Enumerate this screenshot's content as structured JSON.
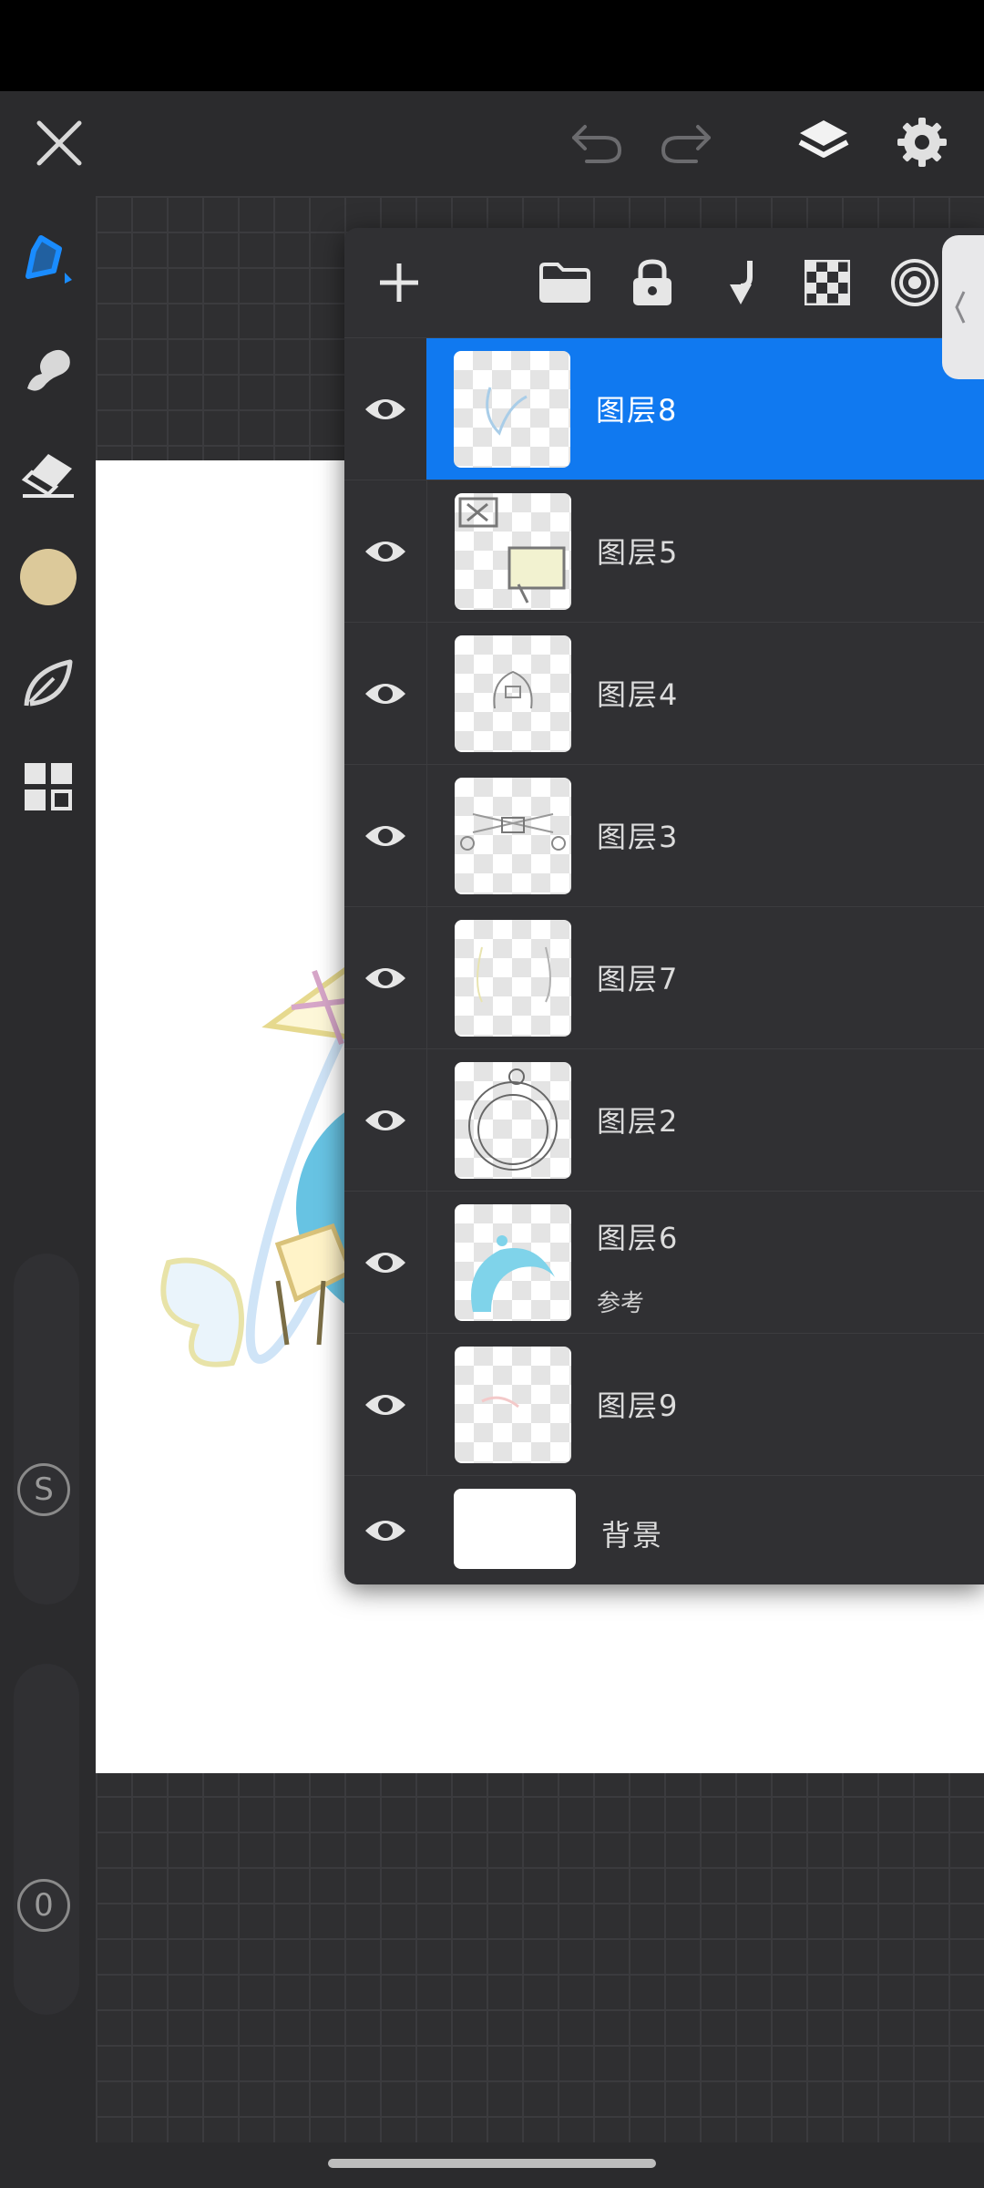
{
  "colors": {
    "accent": "#1079f0",
    "current_color": "#dcc99a",
    "panel_bg": "#303033",
    "toolbar_bg": "#2b2b2d"
  },
  "topbar": {
    "icons": [
      "close-icon",
      "undo-icon",
      "redo-icon",
      "layers-icon",
      "settings-icon"
    ]
  },
  "toolbar": {
    "tools": [
      "brush-icon",
      "smudge-icon",
      "eraser-icon",
      "color-swatch",
      "leaf-icon",
      "grid-icon"
    ],
    "size_slider_label": "S",
    "opacity_slider_label": "0"
  },
  "layers_panel": {
    "header_icons": [
      "add-icon",
      "folder-icon",
      "lock-icon",
      "merge-down-icon",
      "checker-icon",
      "reference-icon"
    ],
    "layers": [
      {
        "name": "图层8",
        "sub": "",
        "selected": true
      },
      {
        "name": "图层5",
        "sub": "",
        "selected": false
      },
      {
        "name": "图层4",
        "sub": "",
        "selected": false
      },
      {
        "name": "图层3",
        "sub": "",
        "selected": false
      },
      {
        "name": "图层7",
        "sub": "",
        "selected": false
      },
      {
        "name": "图层2",
        "sub": "",
        "selected": false
      },
      {
        "name": "图层6",
        "sub": "参考",
        "selected": false
      },
      {
        "name": "图层9",
        "sub": "",
        "selected": false
      }
    ],
    "background_layer": "背景"
  }
}
